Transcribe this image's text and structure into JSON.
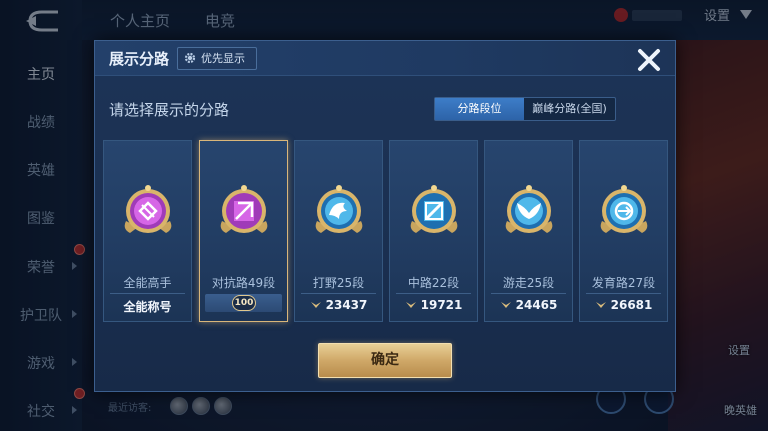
{
  "top_bar": {
    "tabs": [
      "个人主页",
      "电竞"
    ],
    "settings_label": "设置"
  },
  "sidebar": {
    "items": [
      {
        "label": "主页",
        "active": true
      },
      {
        "label": "战绩",
        "active": false
      },
      {
        "label": "英雄",
        "active": false
      },
      {
        "label": "图鉴",
        "active": false
      },
      {
        "label": "荣誉",
        "active": false
      },
      {
        "label": "护卫队",
        "active": false
      },
      {
        "label": "游戏",
        "active": false
      },
      {
        "label": "社交",
        "active": false
      }
    ]
  },
  "background": {
    "visitors_label": "最近访客:",
    "right_labels": [
      "设置",
      "晚英雄"
    ]
  },
  "modal": {
    "title": "展示分路",
    "priority_button": "优先显示",
    "subtitle": "请选择展示的分路",
    "segment_tabs": [
      "分路段位",
      "巅峰分路(全国)"
    ],
    "active_segment": 0,
    "cards": [
      {
        "name": "全能高手",
        "stat": "全能称号",
        "icon": "all-round-emblem",
        "selected": false
      },
      {
        "name": "对抗路49段",
        "badge": "100",
        "icon": "clash-lane-emblem",
        "selected": true
      },
      {
        "name": "打野25段",
        "stat": "23437",
        "icon": "jungle-dragon-emblem",
        "selected": false
      },
      {
        "name": "中路22段",
        "stat": "19721",
        "icon": "mid-lane-emblem",
        "selected": false
      },
      {
        "name": "游走25段",
        "stat": "24465",
        "icon": "roam-wings-emblem",
        "selected": false
      },
      {
        "name": "发育路27段",
        "stat": "26681",
        "icon": "farm-lane-emblem",
        "selected": false
      }
    ],
    "confirm_label": "确定"
  },
  "colors": {
    "accent_blue": "#2d63a8",
    "gold": "#cfa868",
    "selected_border": "#d9b67a"
  }
}
